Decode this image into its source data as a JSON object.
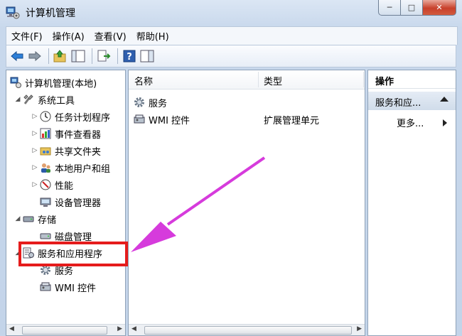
{
  "window": {
    "title": "计算机管理"
  },
  "caption": {
    "minimize": "─",
    "maximize": "□",
    "close": "✕"
  },
  "menu": [
    "文件(F)",
    "操作(A)",
    "查看(V)",
    "帮助(H)"
  ],
  "tree": {
    "root": "计算机管理(本地)",
    "system_tools": "系统工具",
    "task_scheduler": "任务计划程序",
    "event_viewer": "事件查看器",
    "shared_folders": "共享文件夹",
    "local_users": "本地用户和组",
    "performance": "性能",
    "device_manager": "设备管理器",
    "storage": "存储",
    "disk_management": "磁盘管理",
    "services_apps": "服务和应用程序",
    "services": "服务",
    "wmi": "WMI 控件"
  },
  "list": {
    "col_name": "名称",
    "col_type": "类型",
    "rows": [
      {
        "name": "服务",
        "type": ""
      },
      {
        "name": "WMI 控件",
        "type": "扩展管理单元"
      }
    ]
  },
  "actions": {
    "header": "操作",
    "group": "服务和应...",
    "more": "更多..."
  },
  "colors": {
    "highlight": "#e51c1c",
    "arrow": "#d63bdc",
    "accent": "#2a6fc9"
  }
}
